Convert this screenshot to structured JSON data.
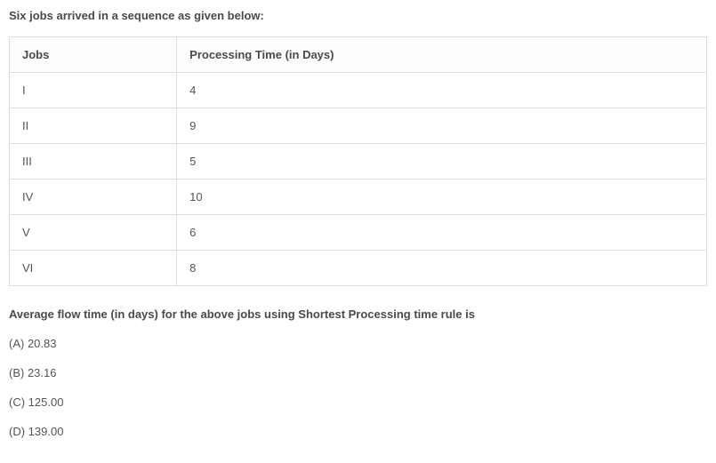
{
  "intro": "Six jobs arrived in a sequence as given below:",
  "table": {
    "headers": {
      "jobs": "Jobs",
      "time": "Processing Time (in Days)"
    },
    "rows": [
      {
        "job": "I",
        "time": "4"
      },
      {
        "job": "II",
        "time": "9"
      },
      {
        "job": "III",
        "time": "5"
      },
      {
        "job": "IV",
        "time": "10"
      },
      {
        "job": "V",
        "time": "6"
      },
      {
        "job": "VI",
        "time": "8"
      }
    ]
  },
  "stem": "Average flow time (in days) for the above jobs using Shortest Processing time rule is",
  "options": {
    "a": "(A) 20.83",
    "b": "(B) 23.16",
    "c": "(C) 125.00",
    "d": "(D) 139.00"
  }
}
